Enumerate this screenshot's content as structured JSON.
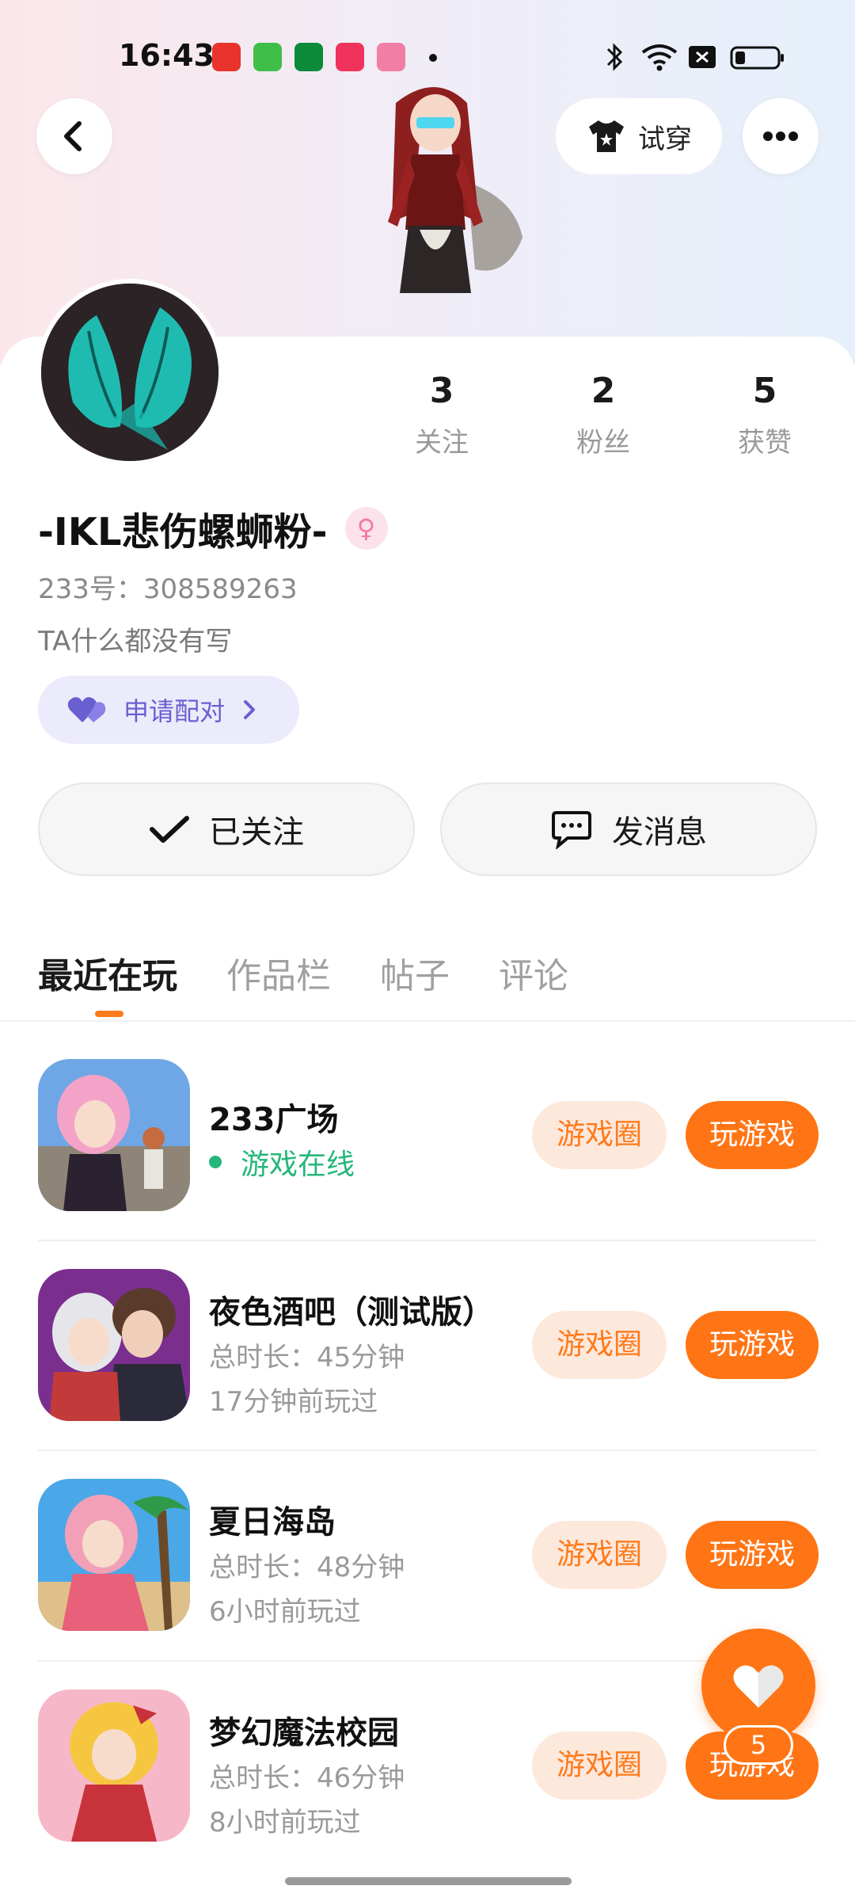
{
  "status_bar": {
    "time": "16:43"
  },
  "header": {
    "tryon_label": "试穿"
  },
  "profile": {
    "name": "-IKL悲伤螺蛳粉-",
    "gender_symbol": "♀",
    "uid": "233号：308589263",
    "bio": "TA什么都没有写",
    "pair_label": "申请配对",
    "stats": [
      {
        "num": "3",
        "label": "关注"
      },
      {
        "num": "2",
        "label": "粉丝"
      },
      {
        "num": "5",
        "label": "获赞"
      }
    ],
    "follow_label": "已关注",
    "message_label": "发消息"
  },
  "tabs": [
    "最近在玩",
    "作品栏",
    "帖子",
    "评论"
  ],
  "games": [
    {
      "title": "233广场",
      "online": "游戏在线",
      "circle": "游戏圈",
      "play": "玩游戏"
    },
    {
      "title": "夜色酒吧（测试版）",
      "duration": "总时长：45分钟",
      "last": "17分钟前玩过",
      "circle": "游戏圈",
      "play": "玩游戏"
    },
    {
      "title": "夏日海岛",
      "duration": "总时长：48分钟",
      "last": "6小时前玩过",
      "circle": "游戏圈",
      "play": "玩游戏"
    },
    {
      "title": "梦幻魔法校园",
      "duration": "总时长：46分钟",
      "last": "8小时前玩过",
      "circle": "游戏圈",
      "play": "玩游戏"
    }
  ],
  "fab": {
    "count": "5"
  },
  "colors": {
    "accent": "#ff7515",
    "online": "#25b779",
    "pair": "#6a5fd0"
  }
}
